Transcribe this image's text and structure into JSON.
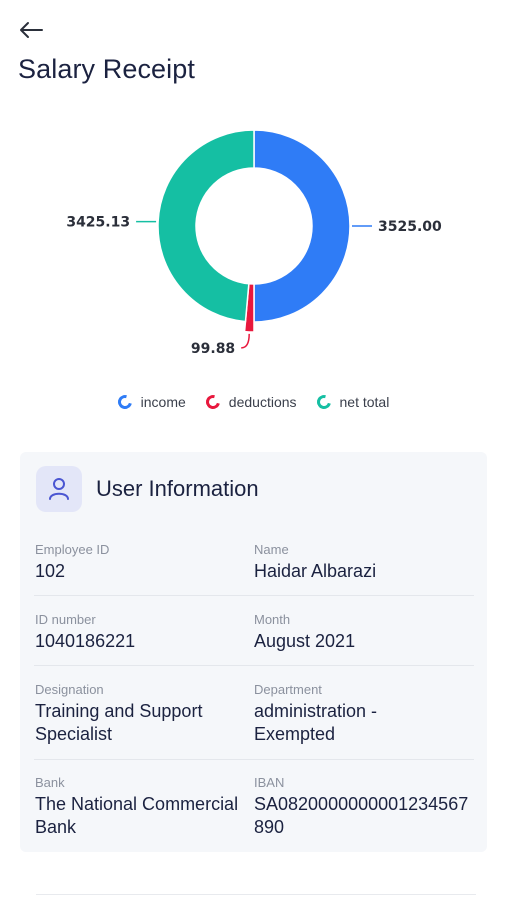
{
  "header": {
    "back_icon": "arrow-left-icon",
    "title": "Salary Receipt"
  },
  "chart_data": {
    "type": "pie",
    "variant": "donut",
    "slices": [
      {
        "name": "income",
        "value": 3525.0,
        "label": "3525.00",
        "color": "#2f7cf6"
      },
      {
        "name": "deductions",
        "value": 99.88,
        "label": "99.88",
        "color": "#e8183d"
      },
      {
        "name": "net total",
        "value": 3425.13,
        "label": "3425.13",
        "color": "#15bfa3"
      }
    ],
    "legend_position": "bottom"
  },
  "legend": {
    "items": [
      {
        "label": "income",
        "color": "#2f7cf6"
      },
      {
        "label": "deductions",
        "color": "#e8183d"
      },
      {
        "label": "net total",
        "color": "#15bfa3"
      }
    ]
  },
  "user_info": {
    "icon": "user-icon",
    "title": "User Information",
    "fields": {
      "employee_id": {
        "label": "Employee ID",
        "value": "102"
      },
      "name": {
        "label": "Name",
        "value": "Haidar Albarazi"
      },
      "id_number": {
        "label": "ID number",
        "value": "1040186221"
      },
      "month": {
        "label": "Month",
        "value": "August 2021"
      },
      "designation": {
        "label": "Designation",
        "value": "Training and Support Specialist"
      },
      "department": {
        "label": "Department",
        "value": "administration - Exempted"
      },
      "bank": {
        "label": "Bank",
        "value": "The National Commercial Bank"
      },
      "iban": {
        "label": "IBAN",
        "value": "SA0820000000001234567890"
      }
    }
  }
}
